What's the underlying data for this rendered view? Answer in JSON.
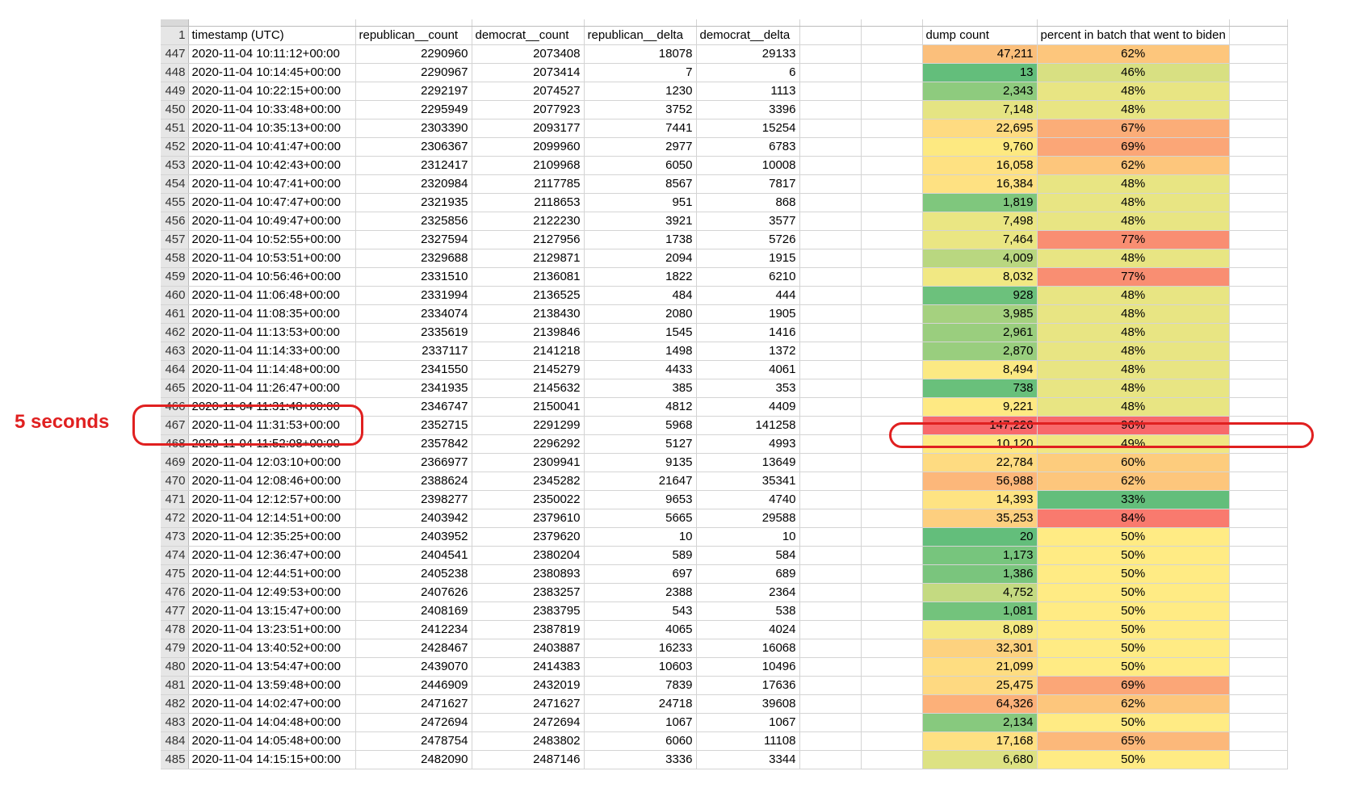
{
  "annotation": {
    "label": "5 seconds"
  },
  "headers": {
    "row_number": "1",
    "timestamp": "timestamp (UTC)",
    "republican_count": "republican__count",
    "democrat_count": "democrat__count",
    "republican_delta": "republican__delta",
    "democrat_delta": "democrat__delta",
    "dump_count": "dump count",
    "percent_biden": "percent in batch that went to biden"
  },
  "colors": {
    "highlight_red": "#e02020",
    "scale_green": "#63be7b",
    "scale_yellow": "#ffeb84",
    "scale_red": "#f8696b",
    "row_header_bg": "#e6e6e6",
    "gridline": "#d4d4d4"
  },
  "rows": [
    {
      "n": "447",
      "ts": "2020-11-04 10:11:12+00:00",
      "rc": "2290960",
      "dc": "2073408",
      "rd": "18078",
      "dd": "29133",
      "dump": "47,211",
      "pct": "62%",
      "dump_color": "#fbbf7b",
      "pct_color": "#fdc67c"
    },
    {
      "n": "448",
      "ts": "2020-11-04 10:14:45+00:00",
      "rc": "2290967",
      "dc": "2073414",
      "rd": "7",
      "dd": "6",
      "dump": "13",
      "pct": "46%",
      "dump_color": "#63be7b",
      "pct_color": "#d8e082"
    },
    {
      "n": "449",
      "ts": "2020-11-04 10:22:15+00:00",
      "rc": "2292197",
      "dc": "2074527",
      "rd": "1230",
      "dd": "1113",
      "dump": "2,343",
      "pct": "48%",
      "dump_color": "#8ecb7e",
      "pct_color": "#e8e583"
    },
    {
      "n": "450",
      "ts": "2020-11-04 10:33:48+00:00",
      "rc": "2295949",
      "dc": "2077923",
      "rd": "3752",
      "dd": "3396",
      "dump": "7,148",
      "pct": "48%",
      "dump_color": "#e5e483",
      "pct_color": "#e8e583"
    },
    {
      "n": "451",
      "ts": "2020-11-04 10:35:13+00:00",
      "rc": "2303390",
      "dc": "2093177",
      "rd": "7441",
      "dd": "15254",
      "dump": "22,695",
      "pct": "67%",
      "dump_color": "#fedb81",
      "pct_color": "#fbad78"
    },
    {
      "n": "452",
      "ts": "2020-11-04 10:41:47+00:00",
      "rc": "2306367",
      "dc": "2099960",
      "rd": "2977",
      "dd": "6783",
      "dump": "9,760",
      "pct": "69%",
      "dump_color": "#fde981",
      "pct_color": "#fba677"
    },
    {
      "n": "453",
      "ts": "2020-11-04 10:42:43+00:00",
      "rc": "2312417",
      "dc": "2109968",
      "rd": "6050",
      "dd": "10008",
      "dump": "16,058",
      "pct": "62%",
      "dump_color": "#fee182",
      "pct_color": "#fdc67c"
    },
    {
      "n": "454",
      "ts": "2020-11-04 10:47:41+00:00",
      "rc": "2320984",
      "dc": "2117785",
      "rd": "8567",
      "dd": "7817",
      "dump": "16,384",
      "pct": "48%",
      "dump_color": "#fee182",
      "pct_color": "#e8e583"
    },
    {
      "n": "455",
      "ts": "2020-11-04 10:47:47+00:00",
      "rc": "2321935",
      "dc": "2118653",
      "rd": "951",
      "dd": "868",
      "dump": "1,819",
      "pct": "48%",
      "dump_color": "#7fc77d",
      "pct_color": "#e8e583"
    },
    {
      "n": "456",
      "ts": "2020-11-04 10:49:47+00:00",
      "rc": "2325856",
      "dc": "2122230",
      "rd": "3921",
      "dd": "3577",
      "dump": "7,498",
      "pct": "48%",
      "dump_color": "#eae683",
      "pct_color": "#e8e583"
    },
    {
      "n": "457",
      "ts": "2020-11-04 10:52:55+00:00",
      "rc": "2327594",
      "dc": "2127956",
      "rd": "1738",
      "dd": "5726",
      "dump": "7,464",
      "pct": "77%",
      "dump_color": "#eae683",
      "pct_color": "#f98e72"
    },
    {
      "n": "458",
      "ts": "2020-11-04 10:53:51+00:00",
      "rc": "2329688",
      "dc": "2129871",
      "rd": "2094",
      "dd": "1915",
      "dump": "4,009",
      "pct": "48%",
      "dump_color": "#b9d780",
      "pct_color": "#e8e583"
    },
    {
      "n": "459",
      "ts": "2020-11-04 10:56:46+00:00",
      "rc": "2331510",
      "dc": "2136081",
      "rd": "1822",
      "dd": "6210",
      "dump": "8,032",
      "pct": "77%",
      "dump_color": "#f1e883",
      "pct_color": "#f98e72"
    },
    {
      "n": "460",
      "ts": "2020-11-04 11:06:48+00:00",
      "rc": "2331994",
      "dc": "2136525",
      "rd": "484",
      "dd": "444",
      "dump": "928",
      "pct": "48%",
      "dump_color": "#6cc17c",
      "pct_color": "#e8e583"
    },
    {
      "n": "461",
      "ts": "2020-11-04 11:08:35+00:00",
      "rc": "2334074",
      "dc": "2138430",
      "rd": "2080",
      "dd": "1905",
      "dump": "3,985",
      "pct": "48%",
      "dump_color": "#a5d17f",
      "pct_color": "#e8e583"
    },
    {
      "n": "462",
      "ts": "2020-11-04 11:13:53+00:00",
      "rc": "2335619",
      "dc": "2139846",
      "rd": "1545",
      "dd": "1416",
      "dump": "2,961",
      "pct": "48%",
      "dump_color": "#9ace7e",
      "pct_color": "#e8e583"
    },
    {
      "n": "463",
      "ts": "2020-11-04 11:14:33+00:00",
      "rc": "2337117",
      "dc": "2141218",
      "rd": "1498",
      "dd": "1372",
      "dump": "2,870",
      "pct": "48%",
      "dump_color": "#99ce7e",
      "pct_color": "#e8e583"
    },
    {
      "n": "464",
      "ts": "2020-11-04 11:14:48+00:00",
      "rc": "2341550",
      "dc": "2145279",
      "rd": "4433",
      "dd": "4061",
      "dump": "8,494",
      "pct": "48%",
      "dump_color": "#fbe983",
      "pct_color": "#e8e583"
    },
    {
      "n": "465",
      "ts": "2020-11-04 11:26:47+00:00",
      "rc": "2341935",
      "dc": "2145632",
      "rd": "385",
      "dd": "353",
      "dump": "738",
      "pct": "48%",
      "dump_color": "#69c07b",
      "pct_color": "#e8e583"
    },
    {
      "n": "466",
      "ts": "2020-11-04 11:31:48+00:00",
      "rc": "2346747",
      "dc": "2150041",
      "rd": "4812",
      "dd": "4409",
      "dump": "9,221",
      "pct": "48%",
      "dump_color": "#fee983",
      "pct_color": "#e8e583"
    },
    {
      "n": "467",
      "ts": "2020-11-04 11:31:53+00:00",
      "rc": "2352715",
      "dc": "2291299",
      "rd": "5968",
      "dd": "141258",
      "dump": "147,226",
      "pct": "96%",
      "dump_color": "#f8696b",
      "pct_color": "#f8696b"
    },
    {
      "n": "468",
      "ts": "2020-11-04 11:52:08+00:00",
      "rc": "2357842",
      "dc": "2296292",
      "rd": "5127",
      "dd": "4993",
      "dump": "10,120",
      "pct": "49%",
      "dump_color": "#fee982",
      "pct_color": "#f0e783"
    },
    {
      "n": "469",
      "ts": "2020-11-04 12:03:10+00:00",
      "rc": "2366977",
      "dc": "2309941",
      "rd": "9135",
      "dd": "13649",
      "dump": "22,784",
      "pct": "60%",
      "dump_color": "#fedb81",
      "pct_color": "#fdcc7d"
    },
    {
      "n": "470",
      "ts": "2020-11-04 12:08:46+00:00",
      "rc": "2388624",
      "dc": "2345282",
      "rd": "21647",
      "dd": "35341",
      "dump": "56,988",
      "pct": "62%",
      "dump_color": "#fcb77a",
      "pct_color": "#fdc67c"
    },
    {
      "n": "471",
      "ts": "2020-11-04 12:12:57+00:00",
      "rc": "2398277",
      "dc": "2350022",
      "rd": "9653",
      "dd": "4740",
      "dump": "14,393",
      "pct": "33%",
      "dump_color": "#fee382",
      "pct_color": "#63be7b"
    },
    {
      "n": "472",
      "ts": "2020-11-04 12:14:51+00:00",
      "rc": "2403942",
      "dc": "2379610",
      "rd": "5665",
      "dd": "29588",
      "dump": "35,253",
      "pct": "84%",
      "dump_color": "#fdcf7f",
      "pct_color": "#f97a6e"
    },
    {
      "n": "473",
      "ts": "2020-11-04 12:35:25+00:00",
      "rc": "2403952",
      "dc": "2379620",
      "rd": "10",
      "dd": "10",
      "dump": "20",
      "pct": "50%",
      "dump_color": "#63be7b",
      "pct_color": "#ffeb84"
    },
    {
      "n": "474",
      "ts": "2020-11-04 12:36:47+00:00",
      "rc": "2404541",
      "dc": "2380204",
      "rd": "589",
      "dd": "584",
      "dump": "1,173",
      "pct": "50%",
      "dump_color": "#77c57d",
      "pct_color": "#ffeb84"
    },
    {
      "n": "475",
      "ts": "2020-11-04 12:44:51+00:00",
      "rc": "2405238",
      "dc": "2380893",
      "rd": "697",
      "dd": "689",
      "dump": "1,386",
      "pct": "50%",
      "dump_color": "#7ac57d",
      "pct_color": "#ffeb84"
    },
    {
      "n": "476",
      "ts": "2020-11-04 12:49:53+00:00",
      "rc": "2407626",
      "dc": "2383257",
      "rd": "2388",
      "dd": "2364",
      "dump": "4,752",
      "pct": "50%",
      "dump_color": "#c4da81",
      "pct_color": "#ffeb84"
    },
    {
      "n": "477",
      "ts": "2020-11-04 13:15:47+00:00",
      "rc": "2408169",
      "dc": "2383795",
      "rd": "543",
      "dd": "538",
      "dump": "1,081",
      "pct": "50%",
      "dump_color": "#73c37c",
      "pct_color": "#ffeb84"
    },
    {
      "n": "478",
      "ts": "2020-11-04 13:23:51+00:00",
      "rc": "2412234",
      "dc": "2387819",
      "rd": "4065",
      "dd": "4024",
      "dump": "8,089",
      "pct": "50%",
      "dump_color": "#f4e983",
      "pct_color": "#ffeb84"
    },
    {
      "n": "479",
      "ts": "2020-11-04 13:40:52+00:00",
      "rc": "2428467",
      "dc": "2403887",
      "rd": "16233",
      "dd": "16068",
      "dump": "32,301",
      "pct": "50%",
      "dump_color": "#fdd27f",
      "pct_color": "#ffeb84"
    },
    {
      "n": "480",
      "ts": "2020-11-04 13:54:47+00:00",
      "rc": "2439070",
      "dc": "2414383",
      "rd": "10603",
      "dd": "10496",
      "dump": "21,099",
      "pct": "50%",
      "dump_color": "#fedd81",
      "pct_color": "#ffeb84"
    },
    {
      "n": "481",
      "ts": "2020-11-04 13:59:48+00:00",
      "rc": "2446909",
      "dc": "2432019",
      "rd": "7839",
      "dd": "17636",
      "dump": "25,475",
      "pct": "69%",
      "dump_color": "#fed981",
      "pct_color": "#fba677"
    },
    {
      "n": "482",
      "ts": "2020-11-04 14:02:47+00:00",
      "rc": "2471627",
      "dc": "2471627",
      "rd": "24718",
      "dd": "39608",
      "dump": "64,326",
      "pct": "62%",
      "dump_color": "#fcb079",
      "pct_color": "#fdc67c"
    },
    {
      "n": "483",
      "ts": "2020-11-04 14:04:48+00:00",
      "rc": "2472694",
      "dc": "2472694",
      "rd": "1067",
      "dd": "1067",
      "dump": "2,134",
      "pct": "50%",
      "dump_color": "#87c97e",
      "pct_color": "#ffeb84"
    },
    {
      "n": "484",
      "ts": "2020-11-04 14:05:48+00:00",
      "rc": "2478754",
      "dc": "2483802",
      "rd": "6060",
      "dd": "11108",
      "dump": "17,168",
      "pct": "65%",
      "dump_color": "#fee082",
      "pct_color": "#fcb87a"
    },
    {
      "n": "485",
      "ts": "2020-11-04 14:15:15+00:00",
      "rc": "2482090",
      "dc": "2487146",
      "rd": "3336",
      "dd": "3344",
      "dump": "6,680",
      "pct": "50%",
      "dump_color": "#dde283",
      "pct_color": "#ffeb84"
    }
  ]
}
